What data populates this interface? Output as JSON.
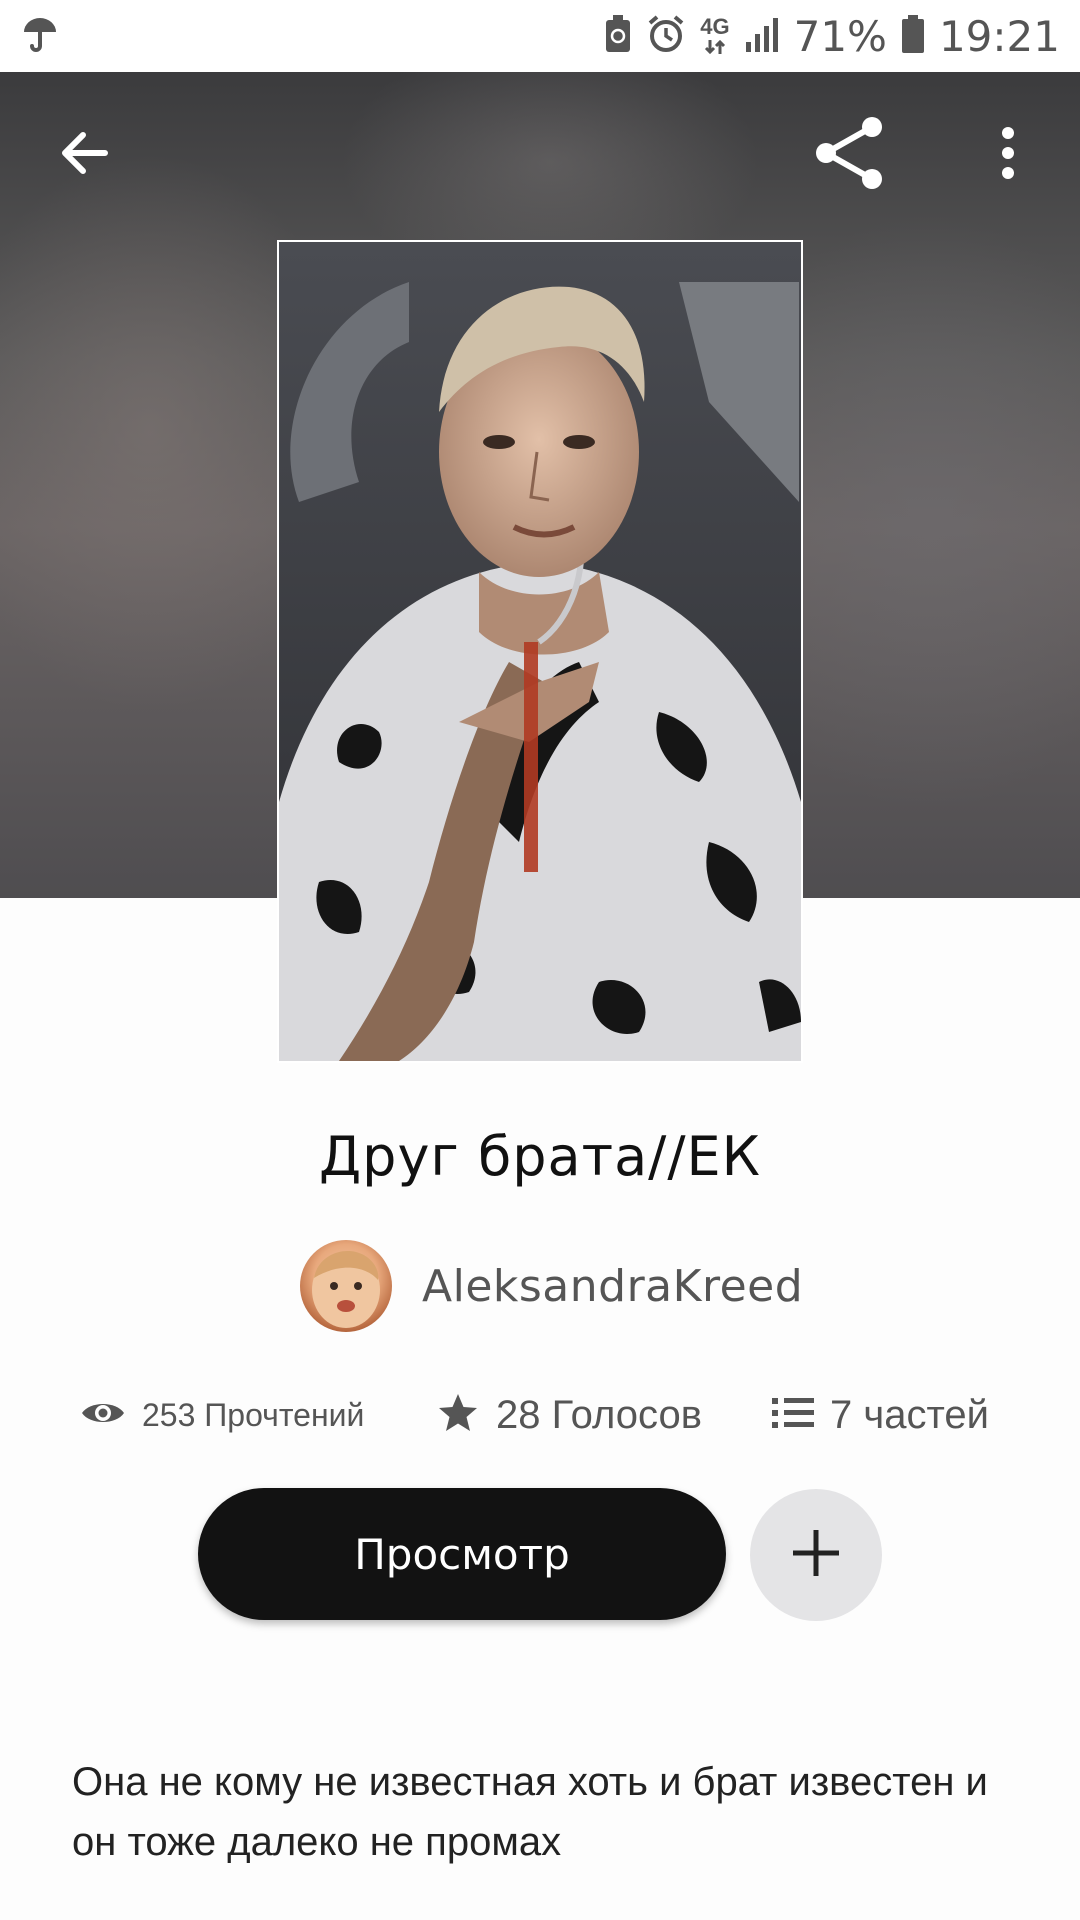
{
  "status_bar": {
    "network": "4G",
    "battery_percent": "71%",
    "time": "19:21",
    "icons": [
      "umbrella-icon",
      "battery-saver-icon",
      "alarm-icon",
      "network-4g-icon",
      "signal-icon",
      "battery-icon"
    ]
  },
  "toolbar": {
    "icons": [
      "back-arrow-icon",
      "share-icon",
      "more-vert-icon"
    ]
  },
  "story": {
    "title": "Друг брата//ЕК",
    "author": "AleksandraKreed",
    "stats": {
      "reads": "253 Прочтений",
      "votes": "28 Голосов",
      "parts": "7 частей"
    },
    "read_button": "Просмотр",
    "description": "Она не кому не известная хоть и брат известен и он тоже далеко не промах"
  },
  "colors": {
    "primary_button": "#121212",
    "secondary_button": "#e4e4e6",
    "text_muted": "#555555",
    "statusbar_bg": "#ffffff"
  }
}
